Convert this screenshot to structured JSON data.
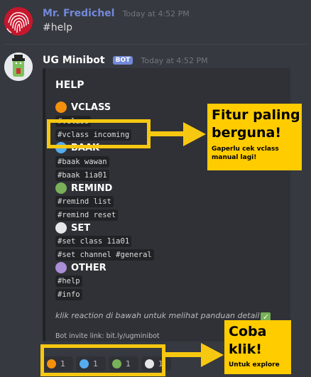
{
  "message1": {
    "author": "Mr. Fredichel",
    "timestamp": "Today at 4:52 PM",
    "text": "#help"
  },
  "message2": {
    "author": "UG Minibot",
    "badge": "BOT",
    "timestamp": "Today at 4:52 PM"
  },
  "embed": {
    "title": "HELP",
    "sections": [
      {
        "name": "VCLASS",
        "color": "#f4900c",
        "commands": [
          "#vclass",
          "#vclass incoming"
        ]
      },
      {
        "name": "BAAK",
        "color": "#55acee",
        "commands": [
          "#baak wawan",
          "#baak 1ia01"
        ]
      },
      {
        "name": "REMIND",
        "color": "#78b159",
        "commands": [
          "#remind list",
          "#remind reset"
        ]
      },
      {
        "name": "SET",
        "color": "#e6e7e8",
        "commands": [
          "#set class 1ia01",
          "#set channel #general"
        ]
      },
      {
        "name": "OTHER",
        "color": "#aa8ed6",
        "commands": [
          "#help",
          "#info"
        ]
      }
    ],
    "instruction": "klik reaction di bawah untuk melihat panduan detail",
    "footer": "Bot invite link: bit.ly/ugminibot"
  },
  "reactions": [
    {
      "color": "#f4900c",
      "count": "1"
    },
    {
      "color": "#55acee",
      "count": "1"
    },
    {
      "color": "#78b159",
      "count": "1"
    },
    {
      "color": "#e6e7e8",
      "count": "1"
    }
  ],
  "callout_top": {
    "title1": "Fitur paling",
    "title2": "berguna!",
    "sub1": "Gaperlu cek vclass",
    "sub2": "manual lagi!"
  },
  "callout_bottom": {
    "title1": "Coba",
    "title2": "klik!",
    "sub": "Untuk explore"
  },
  "colors": {
    "accent_name": "#7289da",
    "highlight": "#f7c811"
  }
}
